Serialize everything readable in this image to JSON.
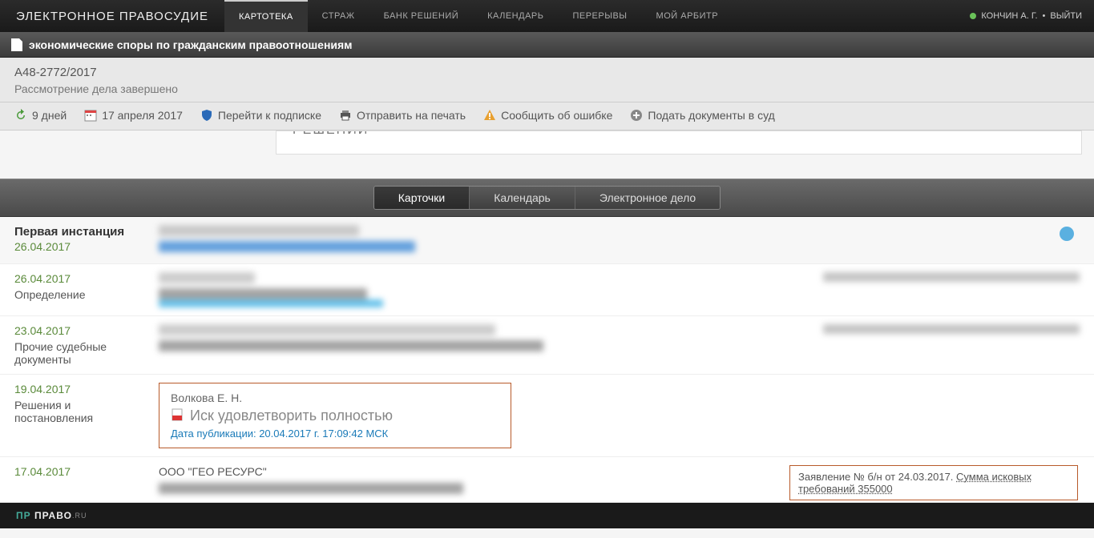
{
  "brand": "ЭЛЕКТРОННОЕ ПРАВОСУДИЕ",
  "nav": {
    "items": [
      "КАРТОТЕКА",
      "СТРАЖ",
      "БАНК РЕШЕНИЙ",
      "КАЛЕНДАРЬ",
      "ПЕРЕРЫВЫ",
      "МОЙ АРБИТР"
    ],
    "active": 0
  },
  "user": {
    "name": "КОНЧИН А. Г.",
    "logout": "ВЫЙТИ"
  },
  "case_type": "экономические споры по гражданским правоотношениям",
  "case": {
    "number": "А48-2772/2017",
    "status": "Рассмотрение дела завершено"
  },
  "toolbar": {
    "days": "9 дней",
    "date": "17 апреля 2017",
    "subscribe": "Перейти к подписке",
    "print": "Отправить на печать",
    "report": "Сообщить об ошибке",
    "submit": "Подать документы в суд"
  },
  "partial_label": "РЕШЕНИЙ",
  "tabs": [
    "Карточки",
    "Календарь",
    "Электронное дело"
  ],
  "tabs_active": 0,
  "instance": {
    "label": "Первая инстанция",
    "date": "26.04.2017"
  },
  "rows": [
    {
      "date": "26.04.2017",
      "type": "Определение"
    },
    {
      "date": "23.04.2017",
      "type": "Прочие судебные документы"
    },
    {
      "date": "19.04.2017",
      "type": "Решения и постановления",
      "author": "Волкова Е. Н.",
      "title": "Иск удовлетворить полностью",
      "pubdate": "Дата публикации: 20.04.2017 г. 17:09:42 МСК"
    },
    {
      "date": "17.04.2017",
      "type": "",
      "org": "ООО \"ГЕО РЕСУРС\"",
      "claim_prefix": "Заявление № б/н от 24.03.2017. ",
      "claim_text": "Сумма исковых требований 355000"
    }
  ],
  "footer": {
    "brand_prefix": "ПР",
    "brand_text": "ПРАВО",
    "brand_suffix": ".RU"
  }
}
